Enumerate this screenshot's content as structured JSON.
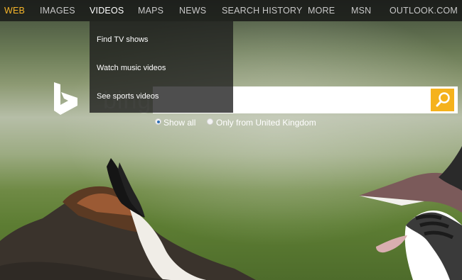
{
  "nav": {
    "items": [
      {
        "label": "WEB",
        "state": "active"
      },
      {
        "label": "IMAGES",
        "state": "normal"
      },
      {
        "label": "VIDEOS",
        "state": "open"
      },
      {
        "label": "MAPS",
        "state": "normal"
      },
      {
        "label": "NEWS",
        "state": "normal"
      },
      {
        "label": "SEARCH HISTORY",
        "state": "normal"
      },
      {
        "label": "MORE",
        "state": "normal"
      },
      {
        "label": "MSN",
        "state": "normal"
      },
      {
        "label": "OUTLOOK.COM",
        "state": "normal"
      }
    ]
  },
  "videos_menu": {
    "items": [
      {
        "label": "Find TV shows"
      },
      {
        "label": "Watch music videos"
      },
      {
        "label": "See sports videos"
      }
    ]
  },
  "logo": {
    "text": "bing",
    "icon": "bing-b-logo-icon"
  },
  "search": {
    "value": "",
    "placeholder": "",
    "button_icon": "search-icon"
  },
  "scope": {
    "options": [
      {
        "label": "Show all",
        "checked": true
      },
      {
        "label": "Only from United Kingdom",
        "checked": false
      }
    ]
  },
  "colors": {
    "accent": "#f5b21d",
    "active_nav": "#f6b52a",
    "nav_text": "#c7c7c7"
  }
}
